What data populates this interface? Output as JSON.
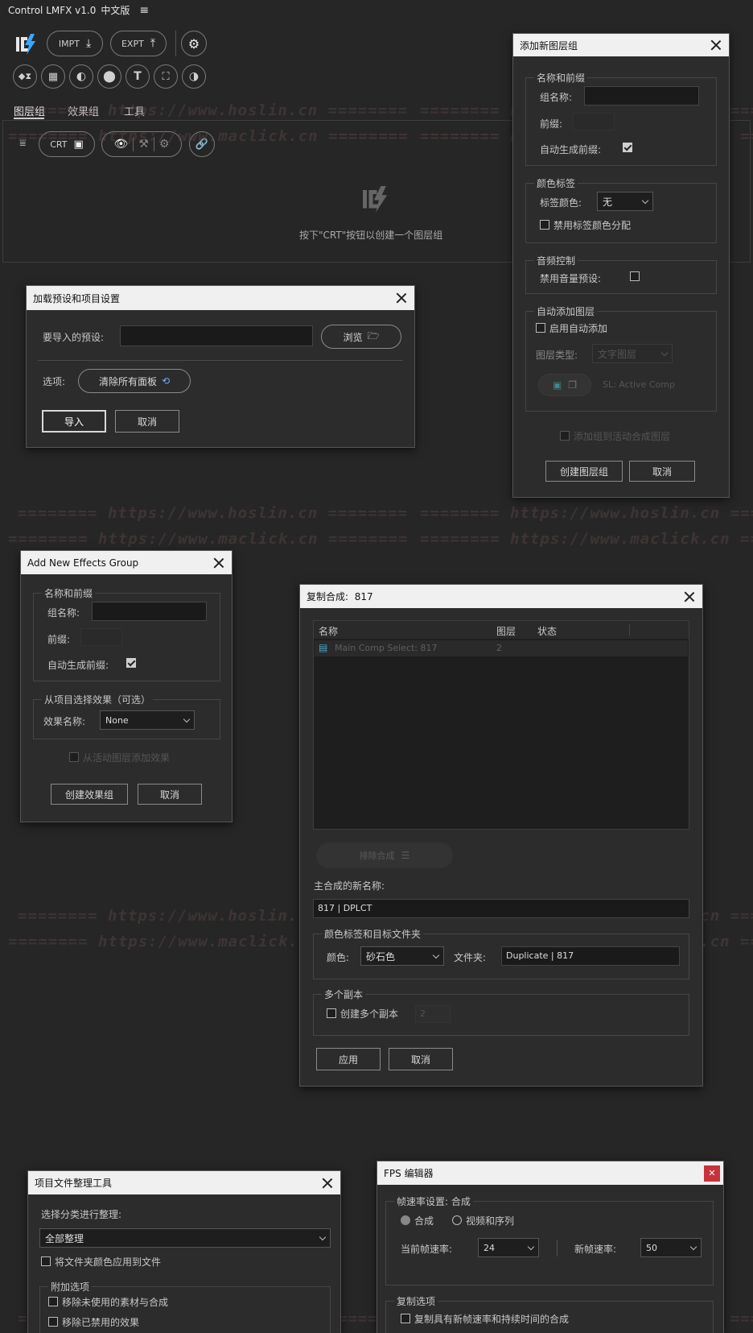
{
  "app": {
    "title": "Control LMFX v1.0",
    "lang": "中文版",
    "impt_label": "IMPT",
    "expt_label": "EXPT",
    "crt_label": "CRT",
    "tabs": [
      "图层组",
      "效果组",
      "工具"
    ],
    "empty_hint": "按下\"CRT\"按钮以创建一个图层组"
  },
  "watermarks": {
    "hoslin": "======== https://www.hoslin.cn ========",
    "maclick": "======== https://www.maclick.cn ========"
  },
  "add_layer_group": {
    "title": "添加新图层组",
    "name_section": "名称和前缀",
    "group_name_label": "组名称:",
    "prefix_label": "前缀:",
    "auto_prefix_label": "自动生成前缀:",
    "color_section": "颜色标签",
    "tag_color_label": "标签颜色:",
    "tag_color_value": "无",
    "disable_tag_color": "禁用标签颜色分配",
    "audio_section": "音频控制",
    "disable_volume": "禁用音量预设:",
    "auto_add_section": "自动添加图层",
    "enable_auto_add": "启用自动添加",
    "layer_type_label": "图层类型:",
    "layer_type_value": "文字图层",
    "active_comp": "SL: Active Comp",
    "add_to_active": "添加组到活动合成图层",
    "create_btn": "创建图层组",
    "cancel_btn": "取消"
  },
  "load_preset": {
    "title": "加载预设和项目设置",
    "preset_label": "要导入的预设:",
    "browse_btn": "浏览",
    "options_label": "选项:",
    "clear_btn": "清除所有面板",
    "import_btn": "导入",
    "cancel_btn": "取消"
  },
  "add_effects": {
    "title": "Add New Effects Group",
    "name_section": "名称和前缀",
    "group_name_label": "组名称:",
    "prefix_label": "前缀:",
    "auto_prefix_label": "自动生成前缀:",
    "select_section": "从项目选择效果（可选）",
    "effect_name_label": "效果名称:",
    "effect_name_value": "None",
    "add_from_active": "从活动图层添加效果",
    "create_btn": "创建效果组",
    "cancel_btn": "取消"
  },
  "duplicate": {
    "title": "复制合成:",
    "title_value": "817",
    "columns": [
      "名称",
      "图层",
      "状态"
    ],
    "row_name": "Main Comp Select: 817",
    "row_layers": "2",
    "exclude_btn": "排除合成",
    "new_name_label": "主合成的新名称:",
    "new_name_value": "817 | DPLCT",
    "color_folder_section": "颜色标签和目标文件夹",
    "color_label": "颜色:",
    "color_value": "砂石色",
    "folder_label": "文件夹:",
    "folder_value": "Duplicate | 817",
    "copies_section": "多个副本",
    "create_copies": "创建多个副本",
    "copies_count": "2",
    "apply_btn": "应用",
    "cancel_btn": "取消"
  },
  "organizer": {
    "title": "项目文件整理工具",
    "select_label": "选择分类进行整理:",
    "select_value": "全部整理",
    "apply_folder_color": "将文件夹颜色应用到文件",
    "extra_section": "附加选项",
    "remove_unused": "移除未使用的素材与合成",
    "remove_disabled": "移除已禁用的效果"
  },
  "fps": {
    "title": "FPS 编辑器",
    "rate_section": "帧速率设置: 合成",
    "radio_comp": "合成",
    "radio_video": "视频和序列",
    "current_label": "当前帧速率:",
    "current_value": "24",
    "new_label": "新帧速率:",
    "new_value": "50",
    "copy_section": "复制选项",
    "copy_new": "复制具有新帧速率和持续时间的合成"
  },
  "colors": {
    "accent_blue": "#3aa7ff",
    "fps_close": "#c8323c"
  }
}
